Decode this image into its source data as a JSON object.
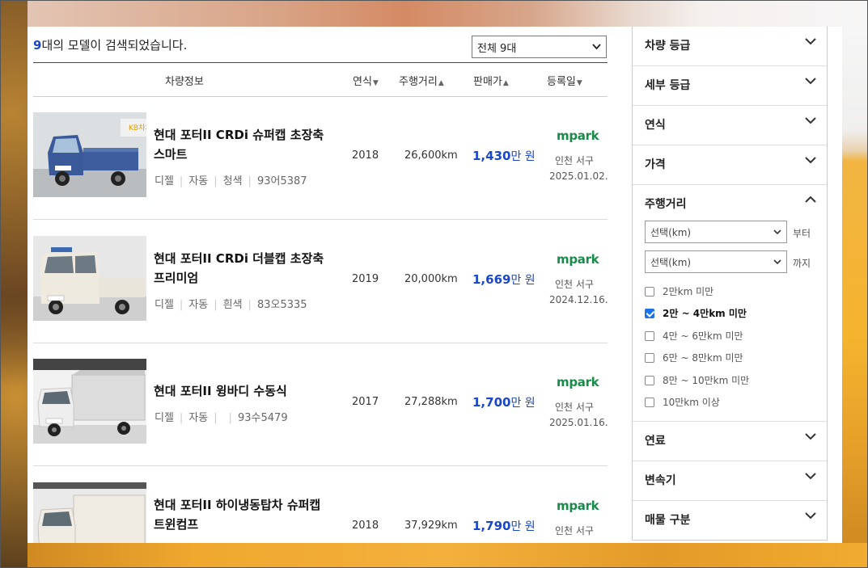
{
  "summary": {
    "count": "9",
    "text": "대의 모델이 검색되었습니다."
  },
  "sort_select": {
    "value": "전체 9대"
  },
  "table_header": {
    "info": "차량정보",
    "year": "연식",
    "mileage": "주행거리",
    "price": "판매가",
    "registered": "등록일"
  },
  "listings": [
    {
      "title_line1": "현대 포터II CRDi 슈퍼캡 초장축",
      "title_line2": "스마트",
      "fuel": "디젤",
      "transmission": "자동",
      "color": "청색",
      "plate": "93어5387",
      "year": "2018",
      "mileage": "26,600km",
      "price": "1,430",
      "price_unit": "만 원",
      "seller": "mpark",
      "location": "인천 서구",
      "date": "2025.01.02."
    },
    {
      "title_line1": "현대 포터II CRDi 더블캡 초장축",
      "title_line2": "프리미엄",
      "fuel": "디젤",
      "transmission": "자동",
      "color": "흰색",
      "plate": "83오5335",
      "year": "2019",
      "mileage": "20,000km",
      "price": "1,669",
      "price_unit": "만 원",
      "seller": "mpark",
      "location": "인천 서구",
      "date": "2024.12.16."
    },
    {
      "title_line1": "현대 포터II 윙바디 수동식",
      "title_line2": "",
      "fuel": "디젤",
      "transmission": "자동",
      "color": "",
      "plate": "93수5479",
      "year": "2017",
      "mileage": "27,288km",
      "price": "1,700",
      "price_unit": "만 원",
      "seller": "mpark",
      "location": "인천 서구",
      "date": "2025.01.16."
    },
    {
      "title_line1": "현대 포터II 하이냉동탑차 슈퍼캡",
      "title_line2": "트윈컴프",
      "fuel": "",
      "transmission": "",
      "color": "",
      "plate": "",
      "year": "2018",
      "mileage": "37,929km",
      "price": "1,790",
      "price_unit": "만 원",
      "seller": "mpark",
      "location": "인천 서구",
      "date": ""
    }
  ],
  "filters": {
    "grade": "차량 등급",
    "sub_grade": "세부 등급",
    "year": "연식",
    "price": "가격",
    "mileage": {
      "title": "주행거리",
      "from_placeholder": "선택(km)",
      "from_label": "부터",
      "to_placeholder": "선택(km)",
      "to_label": "까지",
      "options": [
        {
          "label": "2만km 미만",
          "checked": false
        },
        {
          "label": "2만 ~ 4만km 미만",
          "checked": true
        },
        {
          "label": "4만 ~ 6만km 미만",
          "checked": false
        },
        {
          "label": "6만 ~ 8만km 미만",
          "checked": false
        },
        {
          "label": "8만 ~ 10만km 미만",
          "checked": false
        },
        {
          "label": "10만km 이상",
          "checked": false
        }
      ]
    },
    "fuel": "연료",
    "transmission": "변속기",
    "listing_type": "매물 구분"
  },
  "colors": {
    "accent": "#1a47c8",
    "seller": "#1a8a4a",
    "checkbox": "#1a73e8"
  },
  "thumb_badge": "KB차차차"
}
